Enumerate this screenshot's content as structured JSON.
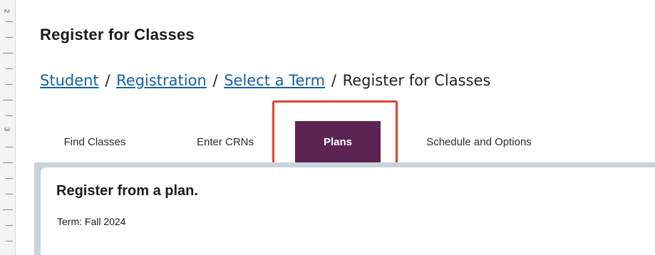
{
  "header": {
    "title": "Register for Classes"
  },
  "breadcrumb": {
    "items": [
      {
        "label": "Student",
        "link": true
      },
      {
        "label": "Registration",
        "link": true
      },
      {
        "label": "Select a Term",
        "link": true
      },
      {
        "label": "Register for Classes",
        "link": false
      }
    ],
    "separator": "/"
  },
  "tabs": [
    {
      "label": "Find Classes",
      "active": false
    },
    {
      "label": "Enter CRNs",
      "active": false
    },
    {
      "label": "Plans",
      "active": true
    },
    {
      "label": "Schedule and Options",
      "active": false
    }
  ],
  "panel": {
    "heading": "Register from a plan.",
    "term_label": "Term:",
    "term_value": "Fall 2024"
  },
  "ruler": {
    "numbers": [
      "2",
      "3"
    ]
  },
  "colors": {
    "active_tab_bg": "#5c2453",
    "link": "#1560a8",
    "highlight_border": "#e0413a",
    "panel_frame": "#c9d3db"
  }
}
